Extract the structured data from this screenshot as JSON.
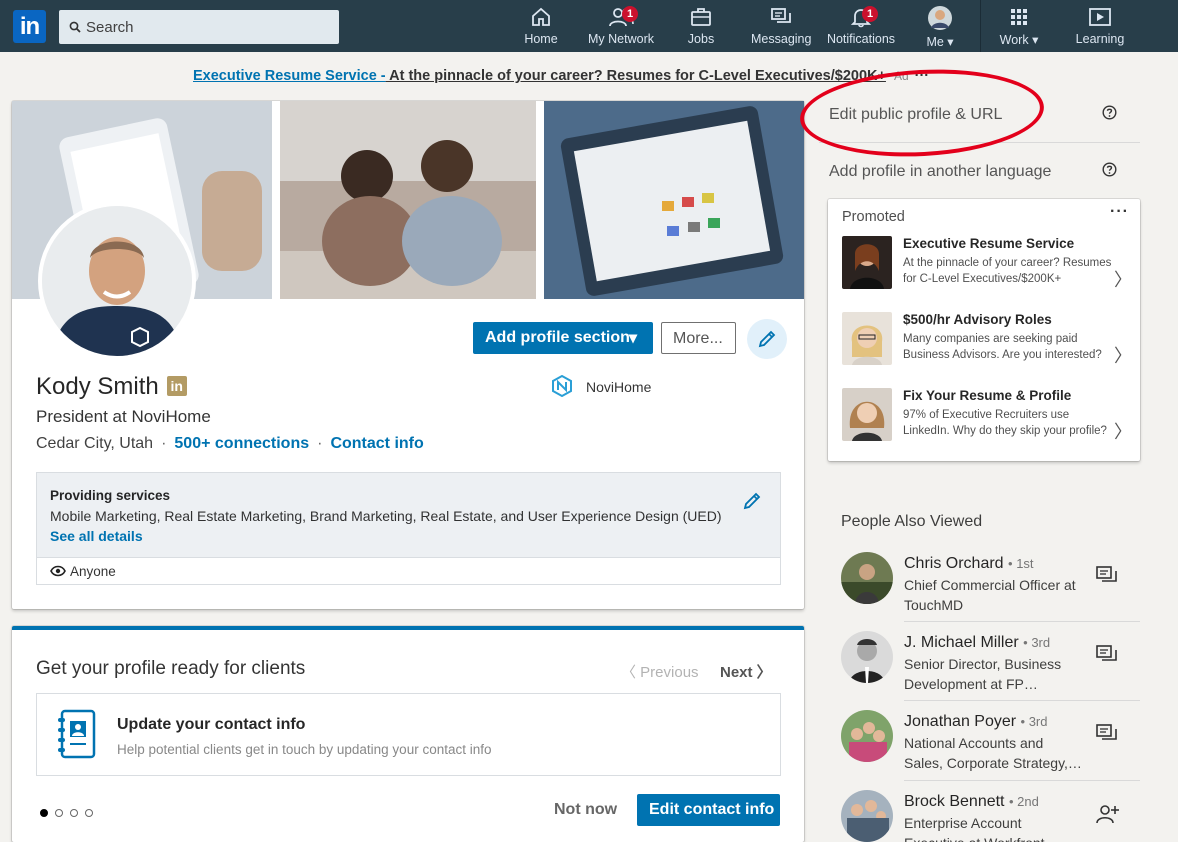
{
  "nav": {
    "search_placeholder": "Search",
    "items": [
      {
        "label": "Home"
      },
      {
        "label": "My Network",
        "badge": "1"
      },
      {
        "label": "Jobs"
      },
      {
        "label": "Messaging"
      },
      {
        "label": "Notifications",
        "badge": "1"
      },
      {
        "label": "Me"
      },
      {
        "label": "Work"
      },
      {
        "label": "Learning"
      }
    ]
  },
  "ad": {
    "link": "Executive Resume Service -",
    "text": " At the pinnacle of your career? Resumes for C-Level Executives/$200K+",
    "tag": "Ad",
    "more": "···"
  },
  "profile": {
    "name": "Kody Smith",
    "in_badge": "in",
    "headline": "President at NoviHome",
    "location": "Cedar City, Utah",
    "connections": "500+ connections",
    "contact": "Contact info",
    "company": "NoviHome",
    "add_section": "Add profile section",
    "more": "More...",
    "services": {
      "title": "Providing services",
      "list": "Mobile Marketing, Real Estate Marketing, Brand Marketing, Real Estate, and User Experience Design (UED)",
      "details": "See all details",
      "visibility": "Anyone"
    }
  },
  "clients": {
    "title": "Get your profile ready for clients",
    "previous": "Previous",
    "next": "Next",
    "task_title": "Update your contact info",
    "task_desc": "Help potential clients get in touch by updating your contact info",
    "not_now": "Not now",
    "edit": "Edit contact info"
  },
  "rail": {
    "edit_public": "Edit public profile & URL",
    "add_language": "Add profile in another language",
    "promoted": {
      "title": "Promoted",
      "more": "···",
      "items": [
        {
          "title": "Executive Resume Service",
          "desc": "At the pinnacle of your career? Resumes for C-Level Executives/$200K+"
        },
        {
          "title": "$500/hr Advisory Roles",
          "desc": "Many companies are seeking paid Business Advisors. Are you interested?"
        },
        {
          "title": "Fix Your Resume & Profile",
          "desc": "97% of Executive Recruiters use LinkedIn. Why do they skip your profile?"
        }
      ]
    },
    "pav_title": "People Also Viewed",
    "people": [
      {
        "name": "Chris Orchard",
        "degree": "1st",
        "headline": "Chief Commercial Officer at TouchMD"
      },
      {
        "name": "J. Michael Miller",
        "degree": "3rd",
        "headline": "Senior Director, Business Development at FP…"
      },
      {
        "name": "Jonathan Poyer",
        "degree": "3rd",
        "headline": "National Accounts and Sales, Corporate Strategy,…"
      },
      {
        "name": "Brock Bennett",
        "degree": "2nd",
        "headline": "Enterprise Account Executive at Workfront"
      }
    ]
  },
  "colors": {
    "nav_bg": "#283e4a",
    "brand": "#0073b1",
    "annotation": "#e3001b"
  }
}
